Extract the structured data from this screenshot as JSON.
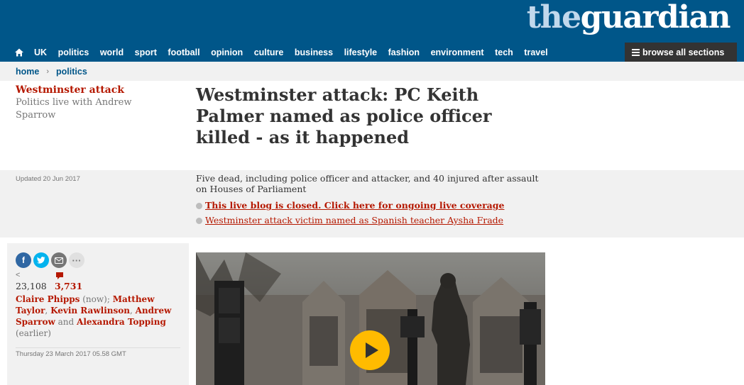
{
  "masthead": {
    "logo_the": "the",
    "logo_guardian": "guardian"
  },
  "nav": {
    "home_icon": "home-icon",
    "items": [
      "UK",
      "politics",
      "world",
      "sport",
      "football",
      "opinion",
      "culture",
      "business",
      "lifestyle",
      "fashion",
      "environment",
      "tech",
      "travel"
    ],
    "browse_label": "browse all sections",
    "browse_icon": "menu-icon"
  },
  "breadcrumb": {
    "home": "home",
    "separator": "›",
    "section": "politics"
  },
  "series": {
    "title": "Westminster attack",
    "subtitle": "Politics live with Andrew Sparrow"
  },
  "headline": "Westminster attack: PC Keith Palmer named as police officer killed - as it happened",
  "updated": "Updated 20 Jun 2017",
  "standfirst": "Five dead, including police officer and attacker, and 40 injured after assault on Houses of Parliament",
  "bullets": [
    "This live blog is closed. Click here for ongoing live coverage",
    "Westminster attack victim named as Spanish teacher Aysha Frade"
  ],
  "share": {
    "facebook_glyph": "f",
    "more_glyph": "···",
    "share_arrow": "<",
    "share_count": "23,108",
    "comment_count": "3,731"
  },
  "byline": {
    "c1": "Claire Phipps",
    "t1": " (now); ",
    "c2": "Matthew Taylor",
    "t2": ", ",
    "c3": "Kevin Rawlinson",
    "t3": ", ",
    "c4": "Andrew Sparrow",
    "t4": " and ",
    "c5": "Alexandra Topping",
    "t5": " (earlier)"
  },
  "dateline": "Thursday 23 March 2017 05.58 GMT",
  "colors": {
    "brand_blue": "#005689",
    "accent_red": "#b51800",
    "play_yellow": "#ffbb00",
    "panel_grey": "#f1f1f1"
  },
  "video": {
    "play_icon": "play-icon"
  }
}
